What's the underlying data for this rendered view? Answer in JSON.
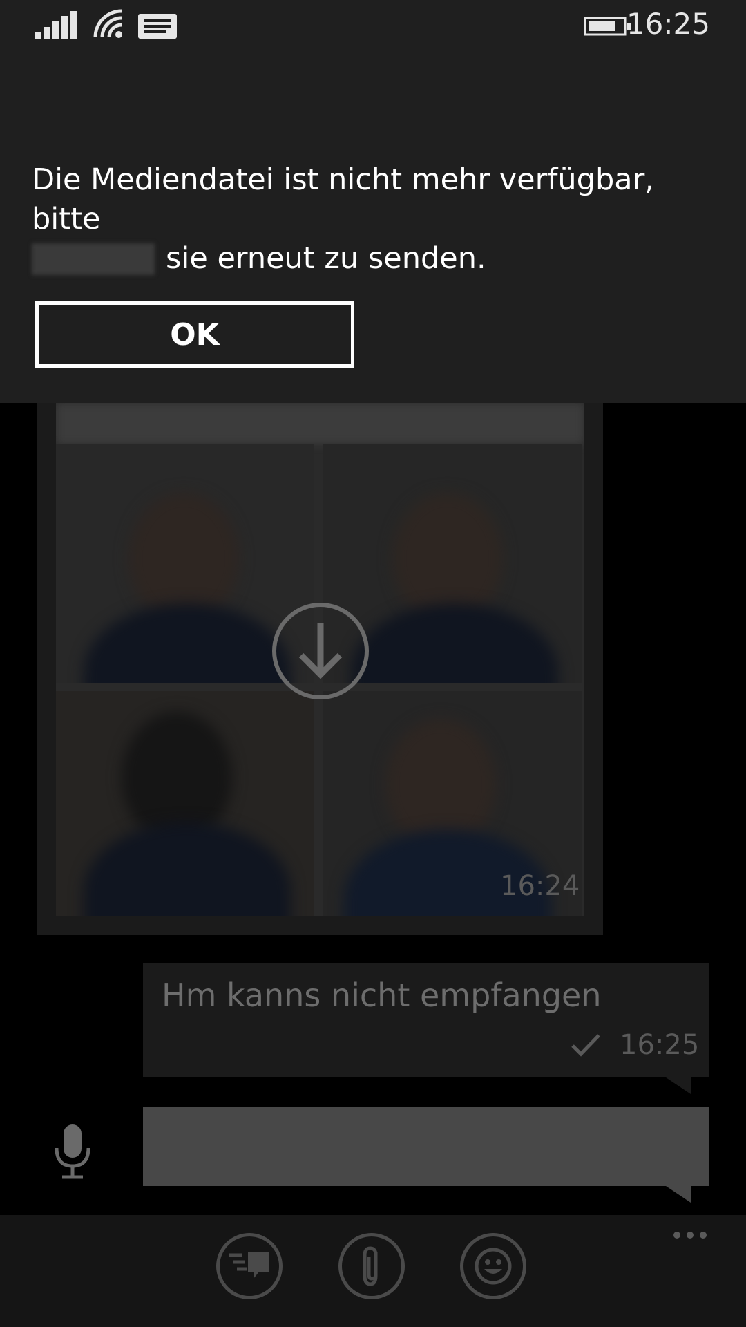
{
  "status_bar": {
    "time": "16:25",
    "icons": [
      "signal-icon",
      "wifi-icon",
      "message-icon",
      "battery-icon"
    ]
  },
  "dialog": {
    "message_part1": "Die Mediendatei ist nicht mehr verfügbar, bitte",
    "message_part2": "sie erneut zu senden.",
    "ok_label": "OK"
  },
  "chat": {
    "image_message": {
      "time": "16:24",
      "overlay_icon": "download-icon"
    },
    "text_message": {
      "text": "Hm kanns nicht empfangen",
      "time": "16:25",
      "status_icon": "check-icon"
    },
    "input": {
      "value": "",
      "mic_icon": "microphone-icon"
    }
  },
  "app_bar": {
    "buttons": [
      "messages-icon",
      "attach-icon",
      "emoji-icon"
    ],
    "more_icon": "more-dots-icon"
  },
  "colors": {
    "dialog_background": "#1f1f1f",
    "page_background": "#000000",
    "input_background": "#484848",
    "app_bar_background": "#151515"
  }
}
